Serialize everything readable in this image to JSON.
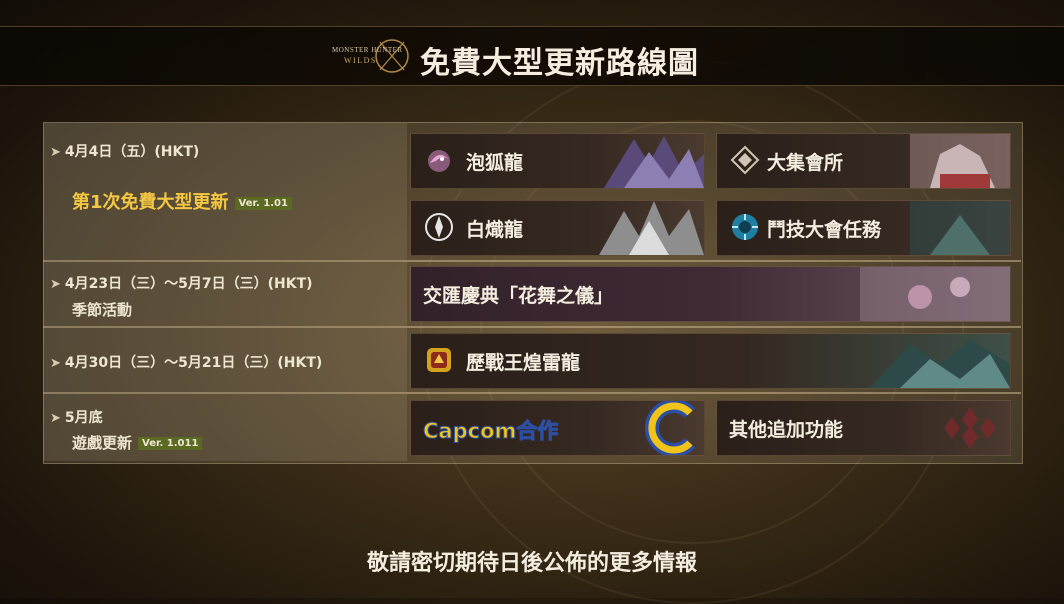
{
  "header": {
    "logo_text": "MONSTER HUNTER WILDS",
    "title": "免費大型更新路線圖"
  },
  "rows": [
    {
      "date": "4月4日（五）(HKT)",
      "label": "第1次免費大型更新",
      "version": "Ver. 1.01",
      "cards": [
        {
          "label": "泡狐龍",
          "icon": "mizutsune-icon"
        },
        {
          "label": "大集會所",
          "icon": "grand-hub-icon"
        },
        {
          "label": "白熾龍",
          "icon": "zoh-shia-icon"
        },
        {
          "label": "鬥技大會任務",
          "icon": "arena-quest-icon"
        }
      ]
    },
    {
      "date": "4月23日（三）～5月7日（三）(HKT)",
      "label": "季節活動",
      "cards": [
        {
          "label": "交匯慶典「花舞之儀」"
        }
      ]
    },
    {
      "date": "4月30日（三）～5月21日（三）(HKT)",
      "cards": [
        {
          "label": "歷戰王煌雷龍",
          "icon": "arch-tempered-rey-dau-icon"
        }
      ]
    },
    {
      "date": "5月底",
      "label": "遊戲更新",
      "version": "Ver. 1.011",
      "cards": [
        {
          "label": "Capcom合作",
          "icon": "capcom-c-icon"
        },
        {
          "label": "其他追加功能",
          "icon": "features-icon"
        }
      ]
    }
  ],
  "footer": "敬請密切期待日後公佈的更多情報",
  "colors": {
    "highlight": "#f5c842",
    "capcom_blue": "#2c4ea3",
    "capcom_yellow": "#f0c419",
    "version_badge": "#5b6a23"
  }
}
